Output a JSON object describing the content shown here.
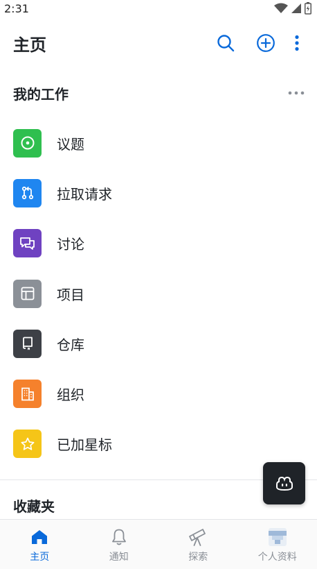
{
  "status_bar": {
    "time": "2:31"
  },
  "app_bar": {
    "title": "主页"
  },
  "my_work": {
    "title": "我的工作",
    "items": [
      {
        "label": "议题",
        "icon": "issue-icon",
        "color": "#2fbf4f"
      },
      {
        "label": "拉取请求",
        "icon": "pull-request-icon",
        "color": "#1f86f0"
      },
      {
        "label": "讨论",
        "icon": "discussion-icon",
        "color": "#6f42c1"
      },
      {
        "label": "项目",
        "icon": "project-icon",
        "color": "#8b9097"
      },
      {
        "label": "仓库",
        "icon": "repository-icon",
        "color": "#3d4046"
      },
      {
        "label": "组织",
        "icon": "organization-icon",
        "color": "#f5812c"
      },
      {
        "label": "已加星标",
        "icon": "star-icon",
        "color": "#f5c518"
      }
    ]
  },
  "favorites": {
    "title": "收藏夹"
  },
  "bottom_nav": {
    "items": [
      {
        "label": "主页",
        "icon": "home-icon",
        "active": true
      },
      {
        "label": "通知",
        "icon": "bell-icon",
        "active": false
      },
      {
        "label": "探索",
        "icon": "telescope-icon",
        "active": false
      },
      {
        "label": "个人资料",
        "icon": "avatar-icon",
        "active": false
      }
    ]
  },
  "colors": {
    "accent": "#0969da",
    "text": "#1f2328",
    "muted": "#8a8f96"
  }
}
